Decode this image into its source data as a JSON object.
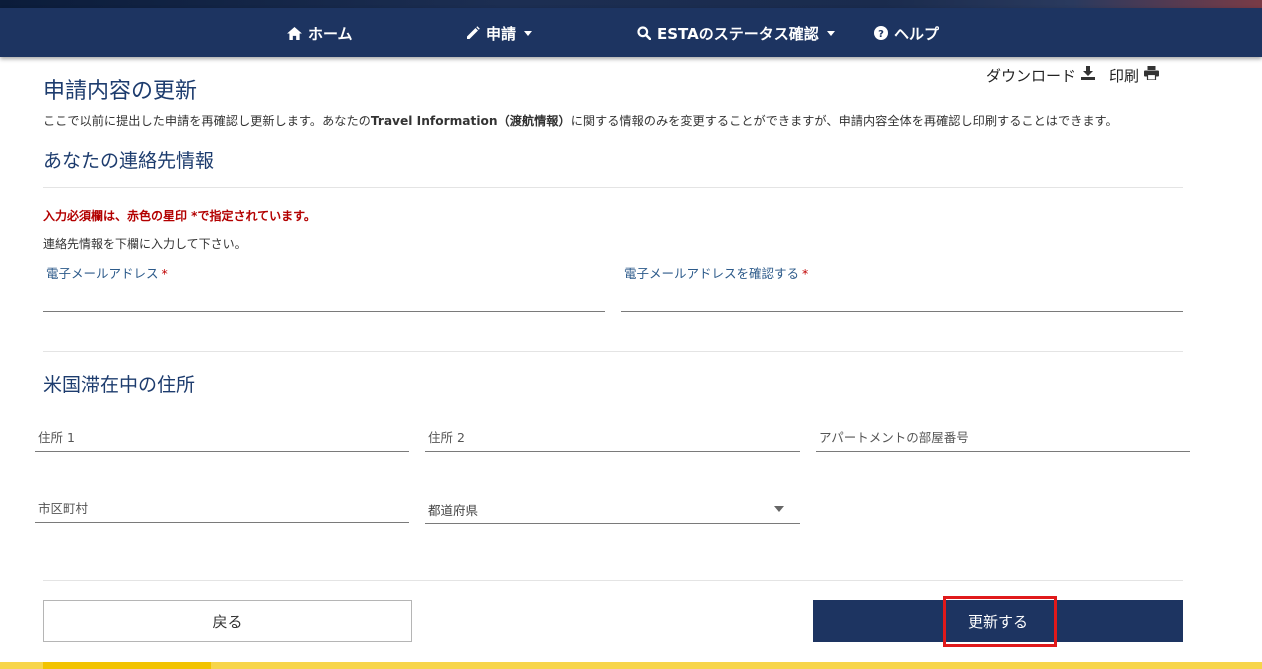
{
  "nav": {
    "home": "ホーム",
    "apply": "申請",
    "status": "ESTAのステータス確認",
    "help": "ヘルプ"
  },
  "page": {
    "title": "申請内容の更新",
    "download": "ダウンロード",
    "print": "印刷",
    "intro_before": "ここで以前に提出した申請を再確認し更新します。あなたの",
    "intro_bold": "Travel Information（渡航情報）",
    "intro_after": "に関する情報のみを変更することができますが、申請内容全体を再確認し印刷することはできます。"
  },
  "contact": {
    "title": "あなたの連絡先情報",
    "required_note": "入力必須欄は、赤色の星印 *で指定されています。",
    "instruction": "連絡先情報を下欄に入力して下さい。",
    "email_label": "電子メールアドレス",
    "email_confirm_label": "電子メールアドレスを確認する",
    "required_star": "*"
  },
  "address": {
    "title": "米国滞在中の住所",
    "address1_placeholder": "住所 1",
    "address2_placeholder": "住所 2",
    "apartment_placeholder": "アパートメントの部屋番号",
    "city_placeholder": "市区町村",
    "state_select": "都道府県"
  },
  "buttons": {
    "back": "戻る",
    "update": "更新する"
  },
  "colors": {
    "navbar": "#1d3461",
    "heading": "#1d3c6e",
    "required": "#b30000",
    "highlight": "#e0191b"
  },
  "icons": {
    "home": "home-icon",
    "apply": "pencil-icon",
    "status": "search-icon",
    "help": "question-circle-icon",
    "download": "download-icon",
    "print": "printer-icon"
  }
}
